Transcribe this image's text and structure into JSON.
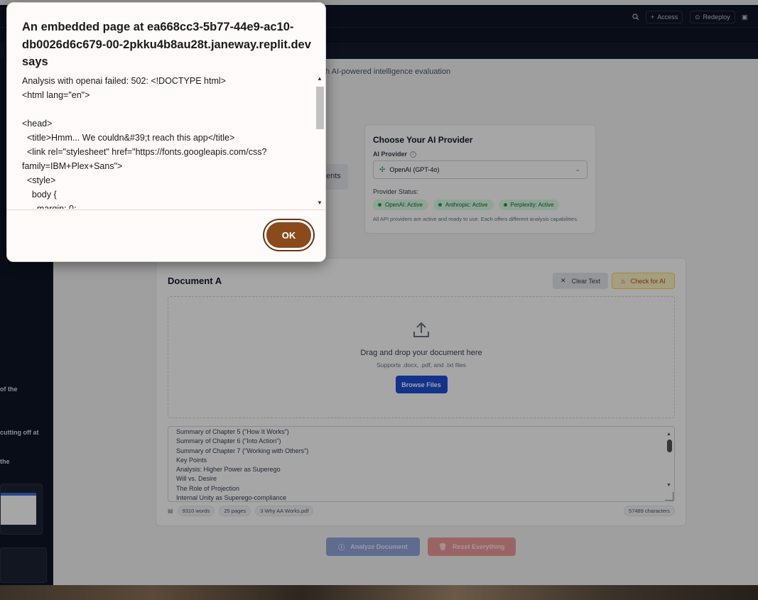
{
  "workspace": {
    "topbar": {
      "access_label": "Access",
      "redeploy_label": "Redeploy"
    },
    "sidebar_snippets": [
      "of the",
      "cutting off at",
      "the"
    ]
  },
  "app": {
    "subtitle_fragment": "th AI-powered intelligence evaluation",
    "doc_b_fragment": "ents",
    "provider": {
      "heading": "Choose Your AI Provider",
      "label": "AI Provider",
      "selected": "OpenAI (GPT-4o)",
      "status_label": "Provider Status:",
      "statuses": [
        "OpenAI: Active",
        "Anthropic: Active",
        "Perplexity: Active"
      ],
      "note": "All API providers are active and ready to use. Each offers different analysis capabilities."
    },
    "document": {
      "title": "Document A",
      "clear_label": "Clear Text",
      "check_label": "Check for AI",
      "drop_title": "Drag and drop your document here",
      "drop_sub": "Supports .docx, .pdf, and .txt files",
      "browse_label": "Browse Files",
      "text_lines": [
        "Summary of Chapter 5 (\"How It Works\")",
        "Summary of Chapter 6 (\"Into Action\")",
        "Summary of Chapter 7 (\"Working with Others\")",
        "Key Points",
        "Analysis: Higher Power as Superego",
        "Will vs. Desire",
        "The Role of Projection",
        "Internal Unity as Superego-compliance"
      ],
      "words": "9310 words",
      "pages": "25 pages",
      "filename": "3 Why AA Works.pdf",
      "characters": "57489 characters"
    },
    "analyze_label": "Analyze Document",
    "reset_label": "Reset Everything"
  },
  "dialog": {
    "title": "An embedded page at ea668cc3-5b77-44e9-ac10-db0026d6c679-00-2pkku4b8au28t.janeway.replit.dev says",
    "message": "Analysis with openai failed: 502: <!DOCTYPE html>\n<html lang=\"en\">\n\n<head>\n  <title>Hmm... We couldn&#39;t reach this app</title>\n  <link rel=\"stylesheet\" href=\"https://fonts.googleapis.com/css?family=IBM+Plex+Sans\">\n  <style>\n    body {\n      margin: 0;",
    "ok_label": "OK"
  },
  "colors": {
    "ok_button": "#8a4a1c",
    "browse_button": "#1d4ed8",
    "status_active": "#16a34a"
  }
}
